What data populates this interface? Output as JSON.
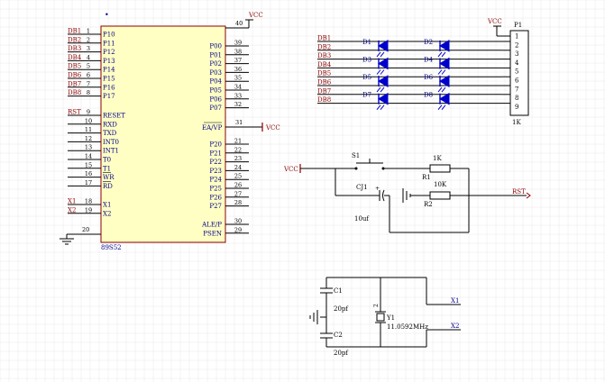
{
  "colors": {
    "grid": "#e8e8e8",
    "chip_fill": "#ffffc4",
    "chip_border": "#8b0000",
    "wire": "#000000",
    "net_red": "#8b0000",
    "net_blue": "#00008b",
    "led_blue": "#0000cc"
  },
  "mcu": {
    "name": "89S52",
    "vcc_pin": "40",
    "vcc_label": "VCC",
    "gnd_pin": "20",
    "left_port": [
      {
        "net": "DB1",
        "pin": "1",
        "name": "P10"
      },
      {
        "net": "DB2",
        "pin": "2",
        "name": "P11"
      },
      {
        "net": "DB3",
        "pin": "3",
        "name": "P12"
      },
      {
        "net": "DB4",
        "pin": "4",
        "name": "P13"
      },
      {
        "net": "DB5",
        "pin": "5",
        "name": "P14"
      },
      {
        "net": "DB6",
        "pin": "6",
        "name": "P15"
      },
      {
        "net": "DB7",
        "pin": "7",
        "name": "P16"
      },
      {
        "net": "DB8",
        "pin": "8",
        "name": "P17"
      }
    ],
    "left_control": [
      {
        "net": "RST",
        "pin": "9",
        "name": "RESET"
      },
      {
        "net": "",
        "pin": "10",
        "name": "RXD"
      },
      {
        "net": "",
        "pin": "11",
        "name": "TXD"
      },
      {
        "net": "",
        "pin": "12",
        "name": "INT0"
      },
      {
        "net": "",
        "pin": "13",
        "name": "INT1"
      },
      {
        "net": "",
        "pin": "14",
        "name": "T0"
      },
      {
        "net": "",
        "pin": "15",
        "name": "T1"
      },
      {
        "net": "",
        "pin": "16",
        "name": "WR"
      },
      {
        "net": "",
        "pin": "17",
        "name": "RD"
      }
    ],
    "left_xtal": [
      {
        "net": "X1",
        "pin": "18",
        "name": "X1"
      },
      {
        "net": "X2",
        "pin": "19",
        "name": "X2"
      }
    ],
    "right_p0": [
      {
        "pin": "39",
        "name": "P00"
      },
      {
        "pin": "38",
        "name": "P01"
      },
      {
        "pin": "37",
        "name": "P02"
      },
      {
        "pin": "36",
        "name": "P03"
      },
      {
        "pin": "35",
        "name": "P04"
      },
      {
        "pin": "34",
        "name": "P05"
      },
      {
        "pin": "33",
        "name": "P06"
      },
      {
        "pin": "32",
        "name": "P07"
      }
    ],
    "ea": {
      "pin": "31",
      "name": "EA/VP",
      "net": "VCC"
    },
    "right_p2": [
      {
        "pin": "21",
        "name": "P20"
      },
      {
        "pin": "22",
        "name": "P21"
      },
      {
        "pin": "23",
        "name": "P22"
      },
      {
        "pin": "24",
        "name": "P23"
      },
      {
        "pin": "25",
        "name": "P24"
      },
      {
        "pin": "26",
        "name": "P25"
      },
      {
        "pin": "27",
        "name": "P26"
      },
      {
        "pin": "28",
        "name": "P27"
      }
    ],
    "right_bottom": [
      {
        "pin": "30",
        "name": "ALE/P"
      },
      {
        "pin": "29",
        "name": "PSEN"
      }
    ]
  },
  "led_array": {
    "nets": [
      "DB1",
      "DB2",
      "DB3",
      "DB4",
      "DB5",
      "DB6",
      "DB7",
      "DB8"
    ],
    "left_labels": [
      "D1",
      "D3",
      "D5",
      "D7"
    ],
    "right_labels": [
      "D2",
      "D4",
      "D6",
      "D8"
    ],
    "connector": {
      "name": "P1",
      "vcc": "VCC",
      "pins": [
        "1",
        "2",
        "3",
        "4",
        "5",
        "6",
        "7",
        "8",
        "9"
      ],
      "value": "1K"
    }
  },
  "reset_circuit": {
    "vcc": "VCC",
    "switch": "S1",
    "capacitor": "CJ1",
    "cap_value": "10uf",
    "r1": "R1",
    "r1_value": "1K",
    "r2": "R2",
    "r2_value": "10K",
    "out_net": "RST"
  },
  "oscillator": {
    "c1": "C1",
    "c1_value": "20pf",
    "c2": "C2",
    "c2_value": "20pf",
    "crystal": "Y1",
    "crystal_pin_top": "2",
    "crystal_value": "11.0592MHz",
    "x1": "X1",
    "x2": "X2"
  }
}
